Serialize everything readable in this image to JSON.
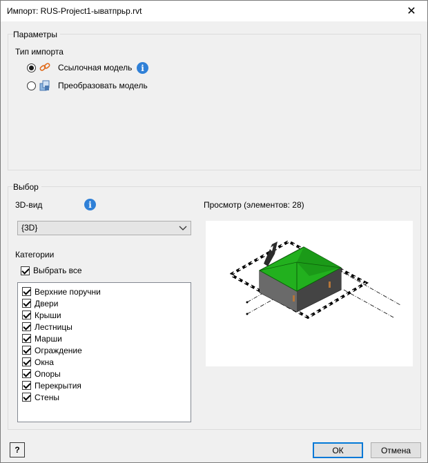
{
  "window": {
    "title": "Импорт: RUS-Project1-ыватпрьр.rvt",
    "close_glyph": "✕"
  },
  "params": {
    "group_label": "Параметры",
    "import_type_label": "Тип импорта",
    "options": [
      {
        "label": "Ссылочная модель",
        "selected": true,
        "icon": "link-icon"
      },
      {
        "label": "Преобразовать модель",
        "selected": false,
        "icon": "convert-model-icon"
      }
    ]
  },
  "selection": {
    "group_label": "Выбор",
    "view_label": "3D-вид",
    "view_value": "{3D}",
    "categories_label": "Категории",
    "select_all_label": "Выбрать все",
    "select_all_checked": true,
    "categories": [
      {
        "label": "Верхние поручни",
        "checked": true
      },
      {
        "label": "Двери",
        "checked": true
      },
      {
        "label": "Крыши",
        "checked": true
      },
      {
        "label": "Лестницы",
        "checked": true
      },
      {
        "label": "Марши",
        "checked": true
      },
      {
        "label": "Ограждение",
        "checked": true
      },
      {
        "label": "Окна",
        "checked": true
      },
      {
        "label": "Опоры",
        "checked": true
      },
      {
        "label": "Перекрытия",
        "checked": true
      },
      {
        "label": "Стены",
        "checked": true
      }
    ],
    "preview_label": "Просмотр (элементов: 28)"
  },
  "footer": {
    "help_glyph": "?",
    "ok_label": "ОК",
    "cancel_label": "Отмена"
  },
  "colors": {
    "roof": "#22b01e",
    "accent": "#0078d7",
    "info": "#2f80d7"
  }
}
